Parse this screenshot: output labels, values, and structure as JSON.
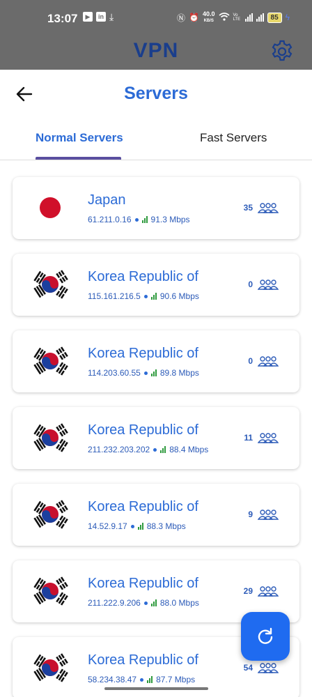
{
  "status_bar": {
    "time": "13:07",
    "speed": "40.0",
    "speed_unit": "KB/S",
    "network": "Vo LTE",
    "battery": "85"
  },
  "app_bar": {
    "title": "VPN"
  },
  "page": {
    "title": "Servers"
  },
  "tabs": [
    {
      "label": "Normal Servers",
      "active": true
    },
    {
      "label": "Fast Servers",
      "active": false
    }
  ],
  "servers": [
    {
      "country": "Japan",
      "flag": "japan-flag",
      "ip": "61.211.0.16",
      "speed": "91.3 Mbps",
      "users": "35"
    },
    {
      "country": "Korea Republic of",
      "flag": "korea-flag",
      "ip": "115.161.216.5",
      "speed": "90.6 Mbps",
      "users": "0"
    },
    {
      "country": "Korea Republic of",
      "flag": "korea-flag",
      "ip": "114.203.60.55",
      "speed": "89.8 Mbps",
      "users": "0"
    },
    {
      "country": "Korea Republic of",
      "flag": "korea-flag",
      "ip": "211.232.203.202",
      "speed": "88.4 Mbps",
      "users": "11"
    },
    {
      "country": "Korea Republic of",
      "flag": "korea-flag",
      "ip": "14.52.9.17",
      "speed": "88.3 Mbps",
      "users": "9"
    },
    {
      "country": "Korea Republic of",
      "flag": "korea-flag",
      "ip": "211.222.9.206",
      "speed": "88.0 Mbps",
      "users": "29"
    },
    {
      "country": "Korea Republic of",
      "flag": "korea-flag",
      "ip": "58.234.38.47",
      "speed": "87.7 Mbps",
      "users": "54"
    }
  ],
  "colors": {
    "accent": "#2c6bd6",
    "app_bar": "#6b6b6b",
    "fab": "#1f6bf0",
    "signal": "#2e9a3d"
  }
}
